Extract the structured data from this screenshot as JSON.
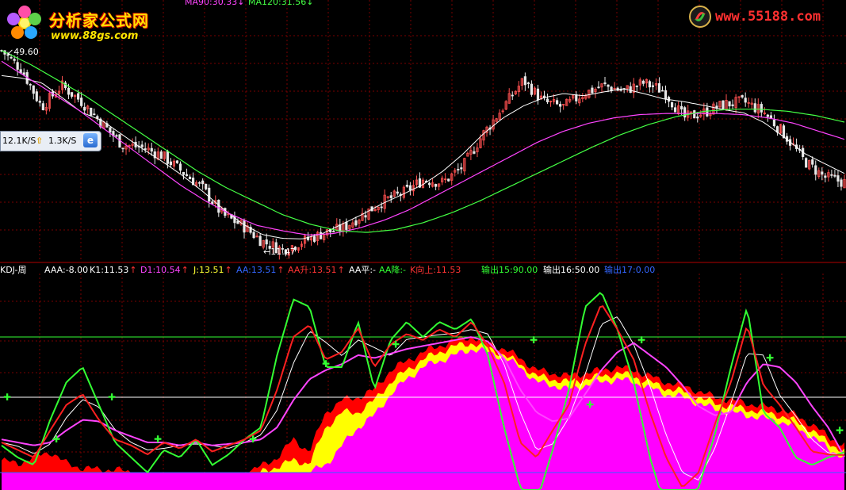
{
  "top_legend": [
    {
      "text": "MA90:30.33",
      "color": "#ff44ff"
    },
    {
      "text": "MA120:31.56",
      "color": "#44ff44"
    }
  ],
  "price_labels": {
    "high": "49.60",
    "low": "11.47"
  },
  "logos": {
    "left_cn": "分析家公式网",
    "left_url": "www.88gs.com",
    "right_url": "www.55188.com"
  },
  "speed_widget": {
    "down": "12.1K/S",
    "up": "1.3K/S"
  },
  "indicator_legend": [
    {
      "text": "KDJ-周",
      "color": "#ffffff"
    },
    {
      "text": "AAA:-8.00",
      "color": "#ffffff"
    },
    {
      "text": "K1:11.53",
      "color": "#ffffff"
    },
    {
      "text": "D1:10.54",
      "color": "#ff44ff"
    },
    {
      "text": "J:13.51",
      "color": "#ffff33"
    },
    {
      "text": "AA:13.51",
      "color": "#3366ff"
    },
    {
      "text": "AA升:13.51",
      "color": "#ff3333"
    },
    {
      "text": "AA平:-",
      "color": "#ffffff"
    },
    {
      "text": "AA降:-",
      "color": "#33ff33"
    },
    {
      "text": "K向上:11.53",
      "color": "#ff3333"
    },
    {
      "text": "输出15:90.00",
      "color": "#33ff33"
    },
    {
      "text": "输出16:50.00",
      "color": "#ffffff"
    },
    {
      "text": "输出17:0.00",
      "color": "#3366ff"
    }
  ],
  "colors": {
    "background": "#000000",
    "grid": "#7a0000",
    "up_candle": "#ff5050",
    "down_candle": "#e8e8e8",
    "ma_short": "#ffffff",
    "ma90": "#ff44ff",
    "ma120": "#44ff44",
    "k_line": "#ff2020",
    "d_line": "#ff44ff",
    "j_line": "#33ff33",
    "fill_magenta": "#ff00ff",
    "fill_yellow": "#ffff00",
    "fill_red": "#ff0000",
    "level_90": "#33ff33",
    "level_50": "#ffffff",
    "level_0": "#3366ff"
  },
  "chart_data": [
    {
      "type": "line",
      "panel": "price",
      "ylim": [
        10,
        52
      ],
      "x": [
        0,
        2,
        4,
        6,
        8,
        10,
        12,
        14,
        16,
        18,
        20,
        22,
        24,
        26,
        28,
        30,
        32,
        34,
        36,
        38,
        40,
        42,
        44,
        46,
        48,
        50,
        52,
        54,
        56,
        58,
        60,
        62,
        64,
        66,
        68,
        70,
        72,
        74,
        76,
        78,
        80,
        82,
        84,
        86,
        88,
        90,
        92,
        94,
        96,
        98,
        100
      ],
      "series": [
        {
          "name": "price",
          "values": [
            48.5,
            45.0,
            38.0,
            42.0,
            39.0,
            35.0,
            31.0,
            30.5,
            29.0,
            26.0,
            23.0,
            18.0,
            16.0,
            13.0,
            11.47,
            13.0,
            14.5,
            15.5,
            18.0,
            20.5,
            22.0,
            24.5,
            24.0,
            27.0,
            33.0,
            38.0,
            43.0,
            39.0,
            38.0,
            40.5,
            42.0,
            41.0,
            42.5,
            41.0,
            36.0,
            37.0,
            38.5,
            39.0,
            37.0,
            33.0,
            28.0,
            25.0,
            24.0
          ]
        },
        {
          "name": "MA90",
          "values": [
            46.5,
            43.5,
            40.5,
            37.5,
            34.0,
            30.5,
            27.0,
            23.5,
            20.5,
            18.0,
            16.0,
            15.0,
            14.2,
            14.5,
            15.5,
            17.0,
            19.0,
            21.5,
            24.0,
            26.5,
            29.0,
            31.5,
            33.5,
            35.0,
            36.0,
            36.6,
            36.8,
            36.8,
            36.8,
            36.6,
            36.0,
            35.0,
            33.5,
            32.0
          ]
        },
        {
          "name": "MA120",
          "values": [
            48.5,
            46.0,
            43.0,
            40.0,
            36.5,
            33.0,
            29.5,
            26.0,
            23.0,
            20.5,
            18.0,
            16.2,
            15.0,
            14.7,
            15.2,
            16.5,
            18.3,
            20.5,
            23.0,
            25.5,
            28.0,
            30.5,
            32.8,
            34.7,
            36.2,
            37.2,
            37.6,
            37.6,
            37.2,
            36.4,
            35.2
          ]
        }
      ],
      "markers": [
        {
          "label": "49.60",
          "x_index": 0
        },
        {
          "label": "11.47",
          "x_index": 14
        }
      ]
    },
    {
      "type": "line",
      "panel": "indicator",
      "title": "KDJ-周",
      "ylim": [
        0,
        100
      ],
      "levels": [
        90,
        50,
        0
      ],
      "series": [
        {
          "name": "K1",
          "values": [
            20,
            15,
            10,
            28,
            45,
            52,
            35,
            22,
            18,
            12,
            20,
            16,
            22,
            14,
            18,
            22,
            28,
            55,
            90,
            98,
            75,
            80,
            96,
            70,
            85,
            92,
            88,
            95,
            90,
            100,
            84,
            60,
            20,
            10,
            28,
            45,
            85,
            112,
            95,
            75,
            40,
            10,
            -10,
            0,
            32,
            60,
            98,
            58,
            45,
            30,
            14,
            12,
            11.53
          ]
        },
        {
          "name": "D1",
          "values": [
            22,
            20,
            18,
            20,
            28,
            35,
            34,
            28,
            24,
            20,
            20,
            18,
            20,
            18,
            19,
            20,
            22,
            30,
            48,
            62,
            68,
            72,
            78,
            76,
            79,
            82,
            84,
            86,
            88,
            90,
            87,
            76,
            55,
            40,
            34,
            36,
            52,
            68,
            80,
            86,
            78,
            70,
            58,
            44,
            38,
            40,
            60,
            72,
            70,
            60,
            44,
            30,
            10.54
          ]
        },
        {
          "name": "J",
          "values": [
            18,
            10,
            5,
            35,
            60,
            70,
            45,
            20,
            10,
            0,
            15,
            10,
            22,
            5,
            12,
            22,
            30,
            78,
            115,
            110,
            70,
            70,
            100,
            55,
            88,
            100,
            90,
            100,
            95,
            102,
            78,
            30,
            -10,
            -20,
            15,
            55,
            110,
            120,
            95,
            60,
            10,
            -25,
            -35,
            -10,
            25,
            70,
            110,
            40,
            30,
            10,
            5,
            10,
            13.51
          ]
        },
        {
          "name": "fill_magenta",
          "values": [
            0,
            0,
            0,
            0,
            0,
            0,
            0,
            0,
            0,
            0,
            0,
            0,
            0,
            0,
            0,
            0,
            0,
            0,
            0,
            0,
            5,
            18,
            30,
            38,
            52,
            62,
            70,
            74,
            78,
            82,
            80,
            76,
            70,
            60,
            58,
            55,
            58,
            60,
            62,
            60,
            56,
            52,
            50,
            46,
            42,
            40,
            38,
            36,
            34,
            30,
            24,
            16,
            10
          ]
        },
        {
          "name": "fill_yellow",
          "values": [
            0,
            0,
            0,
            0,
            0,
            0,
            0,
            0,
            0,
            0,
            0,
            0,
            0,
            0,
            0,
            0,
            0,
            4,
            8,
            6,
            30,
            40,
            40,
            48,
            60,
            68,
            75,
            80,
            84,
            86,
            83,
            78,
            72,
            64,
            62,
            60,
            62,
            64,
            66,
            64,
            60,
            56,
            54,
            50,
            46,
            44,
            42,
            40,
            38,
            34,
            28,
            20,
            14
          ]
        },
        {
          "name": "fill_red",
          "values": [
            8,
            6,
            10,
            14,
            6,
            3,
            2,
            2,
            0,
            0,
            0,
            0,
            0,
            0,
            0,
            0,
            4,
            10,
            22,
            14,
            40,
            48,
            50,
            55,
            68,
            74,
            80,
            84,
            88,
            90,
            86,
            82,
            76,
            68,
            66,
            64,
            66,
            68,
            70,
            68,
            64,
            60,
            58,
            54,
            50,
            48,
            46,
            44,
            42,
            38,
            32,
            24,
            18
          ]
        }
      ]
    }
  ]
}
